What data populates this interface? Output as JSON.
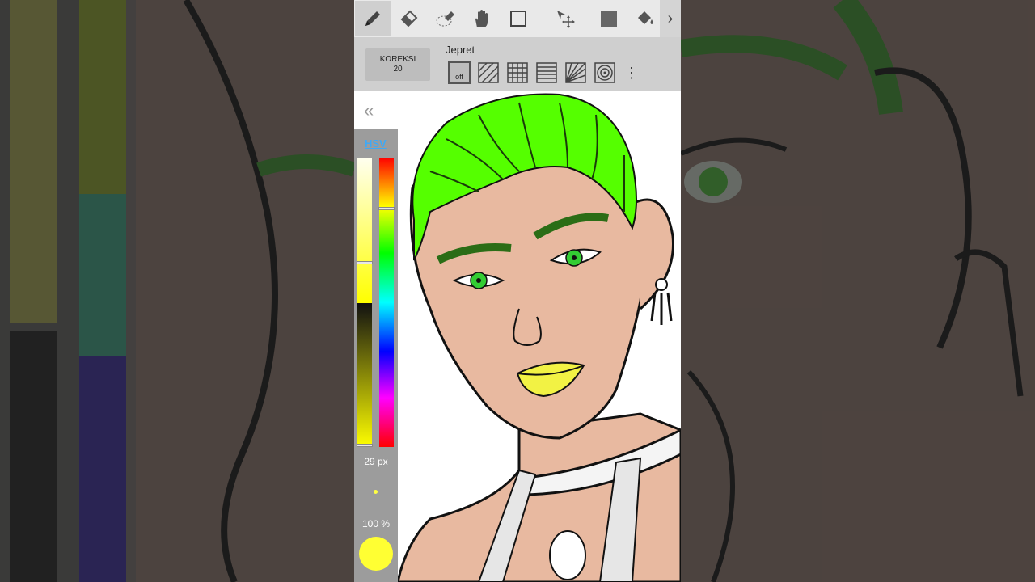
{
  "toolbar": {
    "tools": [
      {
        "name": "pen-icon",
        "active": true
      },
      {
        "name": "eraser-icon",
        "active": false
      },
      {
        "name": "selection-eraser-icon",
        "active": false
      },
      {
        "name": "hand-icon",
        "active": false
      },
      {
        "name": "rectangle-select-icon",
        "active": false
      },
      {
        "name": "move-icon",
        "active": false
      },
      {
        "name": "fill-rect-icon",
        "active": false
      },
      {
        "name": "bucket-icon",
        "active": false
      }
    ],
    "next_glyph": "›"
  },
  "subbar": {
    "correction_label": "KOREKSI",
    "correction_value": "20",
    "snap_label": "Jepret",
    "snap_off_label": "off"
  },
  "collapse_glyph": "«",
  "color_panel": {
    "mode_tab": "HSV",
    "brush_size": "29 px",
    "opacity": "100 %",
    "current_color": "#ffff33"
  },
  "colors": {
    "hair": "#55ff00",
    "skin": "#e8b9a0",
    "lips": "#f2f244",
    "eyes": "#33cc33"
  }
}
